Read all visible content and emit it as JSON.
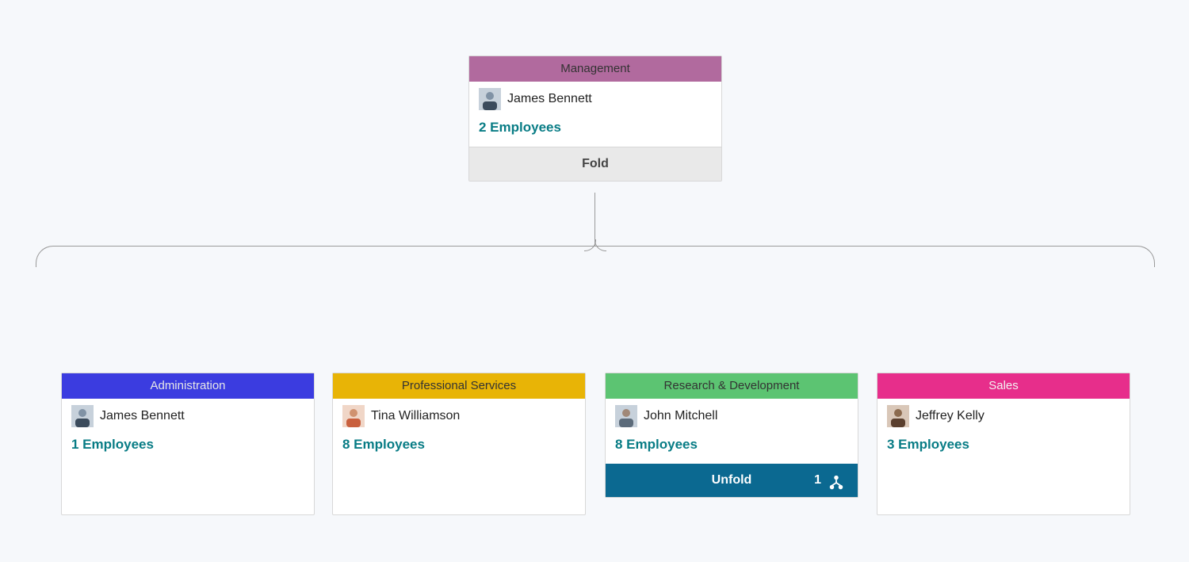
{
  "root": {
    "title": "Management",
    "manager": "James Bennett",
    "employees_label": "2 Employees",
    "fold_label": "Fold",
    "header_color": "#b16a9e"
  },
  "children": [
    {
      "title": "Administration",
      "manager": "James Bennett",
      "employees_label": "1 Employees",
      "header_color": "#3b3ce0",
      "header_text": "#e7e7e7"
    },
    {
      "title": "Professional Services",
      "manager": "Tina Williamson",
      "employees_label": "8 Employees",
      "header_color": "#e8b406",
      "header_text": "#333"
    },
    {
      "title": "Research & Development",
      "manager": "John Mitchell",
      "employees_label": "8 Employees",
      "header_color": "#5cc472",
      "header_text": "#333",
      "unfold_label": "Unfold",
      "unfold_count": "1"
    },
    {
      "title": "Sales",
      "manager": "Jeffrey Kelly",
      "employees_label": "3 Employees",
      "header_color": "#e72e8b",
      "header_text": "#f3f3f3"
    }
  ]
}
